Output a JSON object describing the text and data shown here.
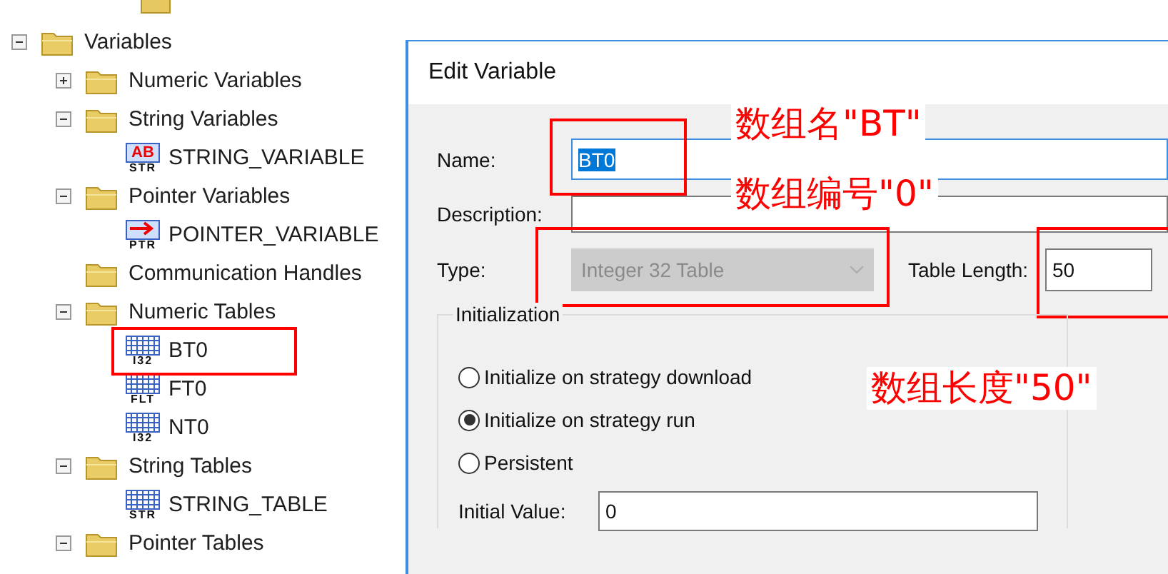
{
  "tree": [
    {
      "kind": "folder",
      "label": "Variables",
      "expanded": true,
      "children": [
        {
          "kind": "folder",
          "label": "Numeric Variables",
          "expanded": false
        },
        {
          "kind": "folder",
          "label": "String Variables",
          "expanded": true,
          "children": [
            {
              "kind": "string",
              "label": "STRING_VARIABLE",
              "glyph": "AB",
              "badge": "STR"
            }
          ]
        },
        {
          "kind": "folder",
          "label": "Pointer Variables",
          "expanded": true,
          "children": [
            {
              "kind": "pointer",
              "label": "POINTER_VARIABLE",
              "badge": "PTR"
            }
          ]
        },
        {
          "kind": "folder",
          "label": "Communication Handles"
        },
        {
          "kind": "folder",
          "label": "Numeric Tables",
          "expanded": true,
          "children": [
            {
              "kind": "table",
              "label": "BT0",
              "badge": "I32",
              "annotated": true
            },
            {
              "kind": "table",
              "label": "FT0",
              "badge": "FLT"
            },
            {
              "kind": "table",
              "label": "NT0",
              "badge": "I32"
            }
          ]
        },
        {
          "kind": "folder",
          "label": "String Tables",
          "expanded": true,
          "children": [
            {
              "kind": "table",
              "label": "STRING_TABLE",
              "badge": "STR"
            }
          ]
        },
        {
          "kind": "folder",
          "label": "Pointer Tables",
          "expanded": true
        }
      ]
    }
  ],
  "dialog": {
    "title": "Edit Variable",
    "name": {
      "label": "Name:",
      "value": "BT0",
      "annotated": true
    },
    "description": {
      "label": "Description:"
    },
    "type": {
      "label": "Type:",
      "value": "Integer 32 Table",
      "disabled": true,
      "annotated": true
    },
    "table_length": {
      "label": "Table Length:",
      "value": "50",
      "annotated": true
    },
    "initialization": {
      "title": "Initialization",
      "options": [
        {
          "label": "Initialize on strategy download",
          "selected": false
        },
        {
          "label": "Initialize on strategy run",
          "selected": true
        },
        {
          "label": "Persistent",
          "selected": false
        }
      ]
    },
    "initial_value": {
      "label": "Initial Value:",
      "value": "0"
    }
  },
  "annotations": [
    "数组名\"BT\"",
    "数组编号\"0\"",
    "数组长度\"50\""
  ]
}
